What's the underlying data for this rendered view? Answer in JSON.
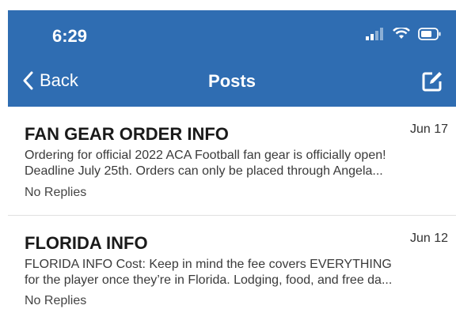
{
  "status_bar": {
    "time": "6:29"
  },
  "nav": {
    "back_label": "Back",
    "title": "Posts"
  },
  "posts": [
    {
      "title": "FAN GEAR ORDER INFO",
      "date": "Jun 17",
      "preview_line1": "Ordering for official 2022 ACA Football fan gear is officially open!",
      "preview_line2": "Deadline July 25th.   Orders can only be placed through Angela...",
      "replies": "No Replies"
    },
    {
      "title": "FLORIDA INFO",
      "date": "Jun 12",
      "preview_line1": "FLORIDA INFO  Cost:  Keep in mind the fee covers EVERYTHING",
      "preview_line2": "for the player once they’re in Florida. Lodging, food, and free da...",
      "replies": "No Replies"
    }
  ],
  "colors": {
    "header": "#2f6db2"
  }
}
